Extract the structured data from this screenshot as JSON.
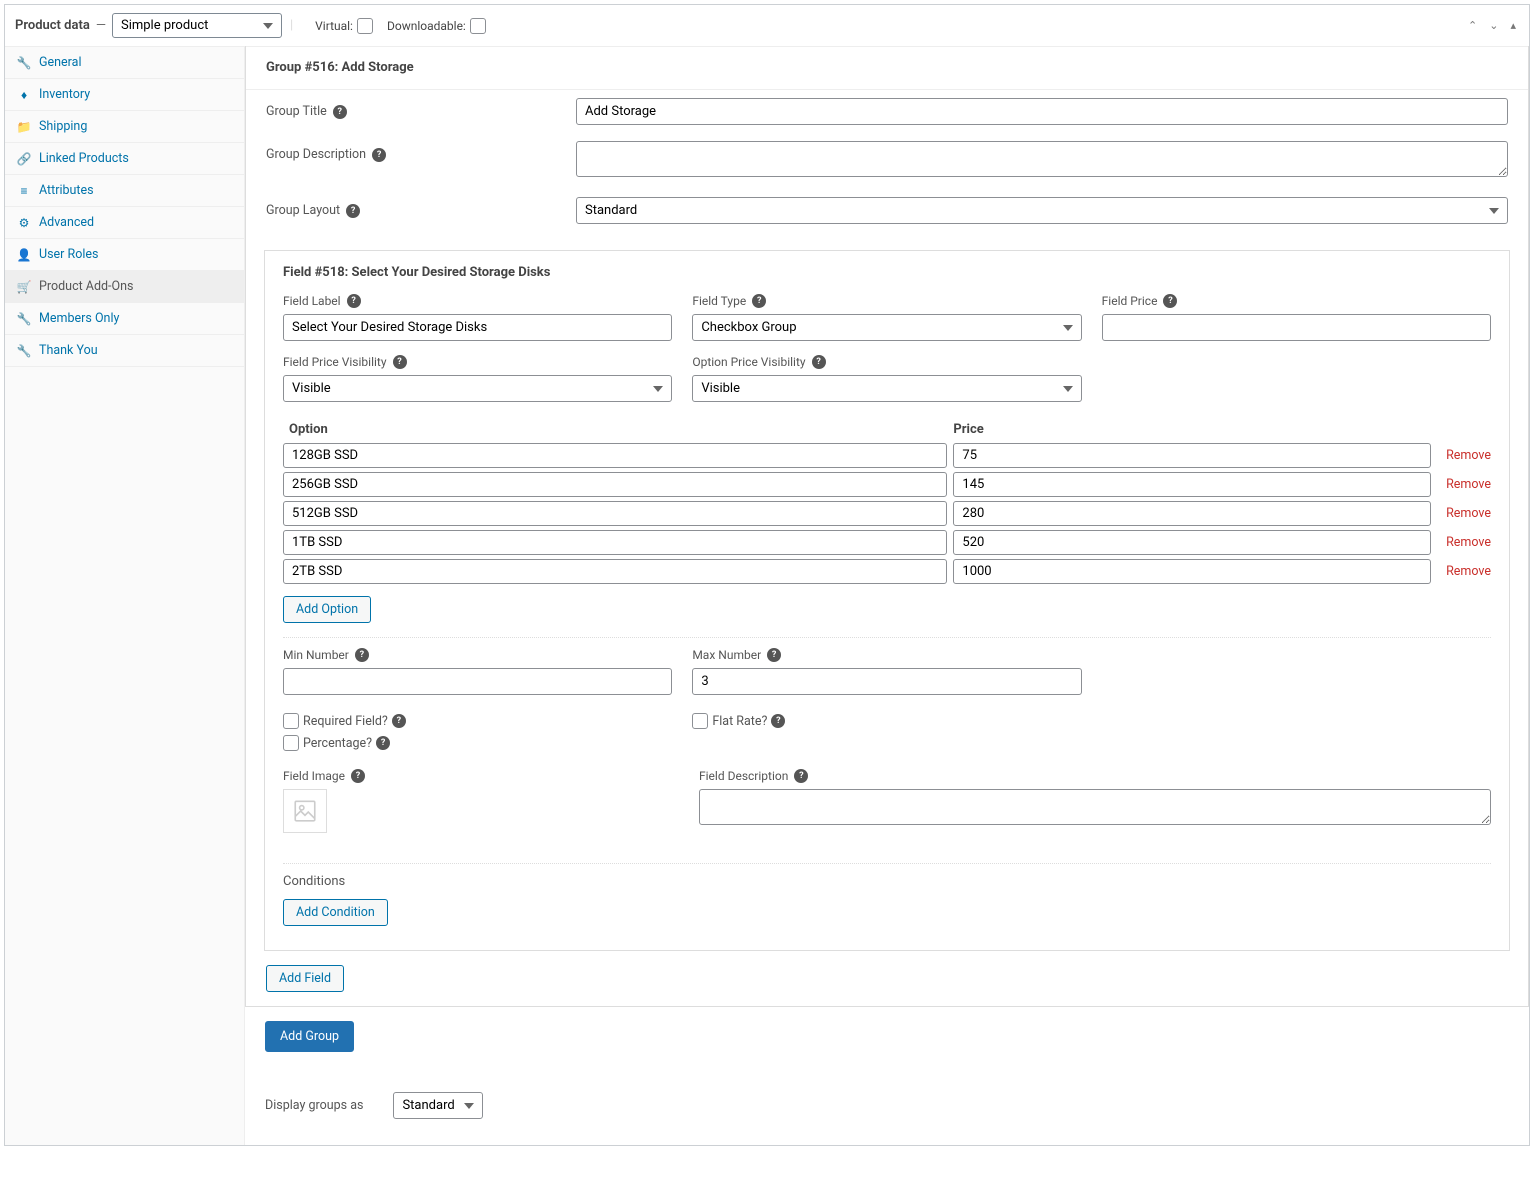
{
  "header": {
    "title": "Product data",
    "product_type": "Simple product",
    "virtual_label": "Virtual:",
    "downloadable_label": "Downloadable:"
  },
  "sidebar": {
    "items": [
      {
        "label": "General"
      },
      {
        "label": "Inventory"
      },
      {
        "label": "Shipping"
      },
      {
        "label": "Linked Products"
      },
      {
        "label": "Attributes"
      },
      {
        "label": "Advanced"
      },
      {
        "label": "User Roles"
      },
      {
        "label": "Product Add-Ons"
      },
      {
        "label": "Members Only"
      },
      {
        "label": "Thank You"
      }
    ]
  },
  "group": {
    "header": "Group #516: Add Storage",
    "title_label": "Group Title",
    "title_value": "Add Storage",
    "desc_label": "Group Description",
    "desc_value": "",
    "layout_label": "Group Layout",
    "layout_value": "Standard"
  },
  "field": {
    "header": "Field #518: Select Your Desired Storage Disks",
    "label_label": "Field Label",
    "label_value": "Select Your Desired Storage Disks",
    "type_label": "Field Type",
    "type_value": "Checkbox Group",
    "price_label": "Field Price",
    "price_value": "",
    "field_price_vis_label": "Field Price Visibility",
    "field_price_vis_value": "Visible",
    "option_price_vis_label": "Option Price Visibility",
    "option_price_vis_value": "Visible",
    "option_header": "Option",
    "price_header": "Price",
    "options": [
      {
        "name": "128GB SSD",
        "price": "75"
      },
      {
        "name": "256GB SSD",
        "price": "145"
      },
      {
        "name": "512GB SSD",
        "price": "280"
      },
      {
        "name": "1TB SSD",
        "price": "520"
      },
      {
        "name": "2TB SSD",
        "price": "1000"
      }
    ],
    "remove_label": "Remove",
    "add_option_label": "Add Option",
    "min_label": "Min Number",
    "min_value": "",
    "max_label": "Max Number",
    "max_value": "3",
    "required_label": "Required Field?",
    "flat_rate_label": "Flat Rate?",
    "percentage_label": "Percentage?",
    "image_label": "Field Image",
    "desc_label": "Field Description",
    "desc_value": "",
    "conditions_label": "Conditions",
    "add_condition_label": "Add Condition"
  },
  "actions": {
    "add_field": "Add Field",
    "add_group": "Add Group"
  },
  "display": {
    "label": "Display groups as",
    "value": "Standard"
  }
}
